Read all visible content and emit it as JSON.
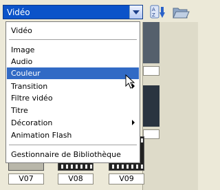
{
  "dropdown": {
    "selected": "Vidéo"
  },
  "menu": {
    "items": [
      {
        "label": "Vidéo",
        "submenu": false
      },
      {
        "label": "Image",
        "submenu": false
      },
      {
        "label": "Audio",
        "submenu": false
      },
      {
        "label": "Couleur",
        "submenu": false,
        "highlighted": true
      },
      {
        "label": "Transition",
        "submenu": true
      },
      {
        "label": "Filtre vidéo",
        "submenu": false
      },
      {
        "label": "Titre",
        "submenu": false
      },
      {
        "label": "Décoration",
        "submenu": true
      },
      {
        "label": "Animation Flash",
        "submenu": false
      },
      {
        "label": "Gestionnaire de Bibliothèque",
        "submenu": false
      }
    ]
  },
  "library": {
    "thumbnails": [
      {
        "label": "V07"
      },
      {
        "label": "V08"
      },
      {
        "label": "V09"
      }
    ]
  },
  "toolbar": {
    "sort_icon": "sort-az-icon",
    "folder_icon": "open-folder-icon"
  },
  "colors": {
    "accent": "#316ac5",
    "combo": "#0b53c9"
  }
}
